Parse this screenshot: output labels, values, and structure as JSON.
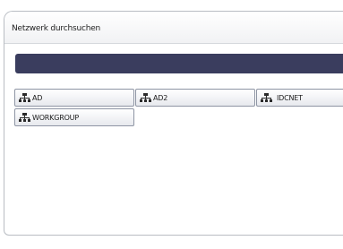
{
  "dialog": {
    "title": "Netzwerk durchsuchen",
    "path": ""
  },
  "workgroups": [
    {
      "label": "AD",
      "icon": "network-group-icon"
    },
    {
      "label": "AD2",
      "icon": "network-group-icon"
    },
    {
      "label": "IDCNET",
      "icon": "network-group-icon"
    },
    {
      "label": "WORKGROUP",
      "icon": "network-group-icon"
    }
  ],
  "colors": {
    "path_bar": "#3a3d5e",
    "button_border": "#8e95a4",
    "icon": "#2a2a2a"
  }
}
